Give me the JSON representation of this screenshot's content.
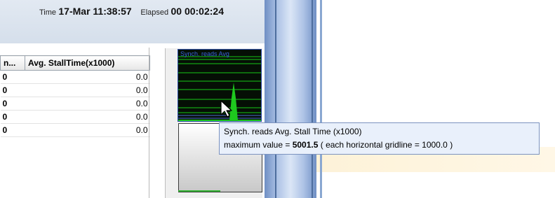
{
  "header": {
    "time_label": "Time",
    "time_value": "17-Mar 11:38:57",
    "elapsed_label": "Elapsed",
    "elapsed_value": "00 00:02:24"
  },
  "table": {
    "columns": [
      "n...",
      "Avg. StallTime(x1000)"
    ],
    "rows": [
      [
        "0",
        "0.0"
      ],
      [
        "0",
        "0.0"
      ],
      [
        "0",
        "0.0"
      ],
      [
        "0",
        "0.0"
      ],
      [
        "0",
        "0.0"
      ]
    ]
  },
  "mini_chart": {
    "title": "Synch. reads  Avg"
  },
  "tooltip": {
    "line1": "Synch. reads Avg. Stall Time (x1000)",
    "line2_prefix": "maximum value = ",
    "line2_value": "5001.5",
    "line2_suffix": " ( each horizontal gridline = 1000.0 )"
  },
  "colors": {
    "chart_green": "#16c616",
    "chart_bg": "#050f05",
    "tooltip_bg": "#e9f0fb",
    "separator_blue": "#6f8fc4"
  },
  "icons": {
    "cursor": "arrow-cursor-icon"
  }
}
